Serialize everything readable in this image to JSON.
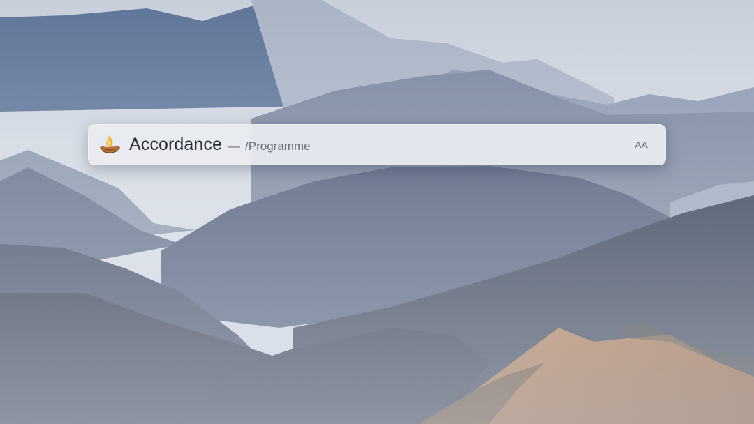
{
  "wallpaper": {
    "description_icon": "mountain-landscape",
    "colors": {
      "sky": "#cfd6e0",
      "far_ridge": "#a9b6c9",
      "mid_ridge": "#7d8aa3",
      "near_ridge": "#4a5874",
      "dark_ridge": "#2b3346",
      "sunlit_hill": "#a86e45"
    }
  },
  "spotlight": {
    "app_icon": "accordance-lamp-icon",
    "app_name": "Accordance",
    "separator": "—",
    "path": "/Programme",
    "mode_indicator": "AA"
  }
}
